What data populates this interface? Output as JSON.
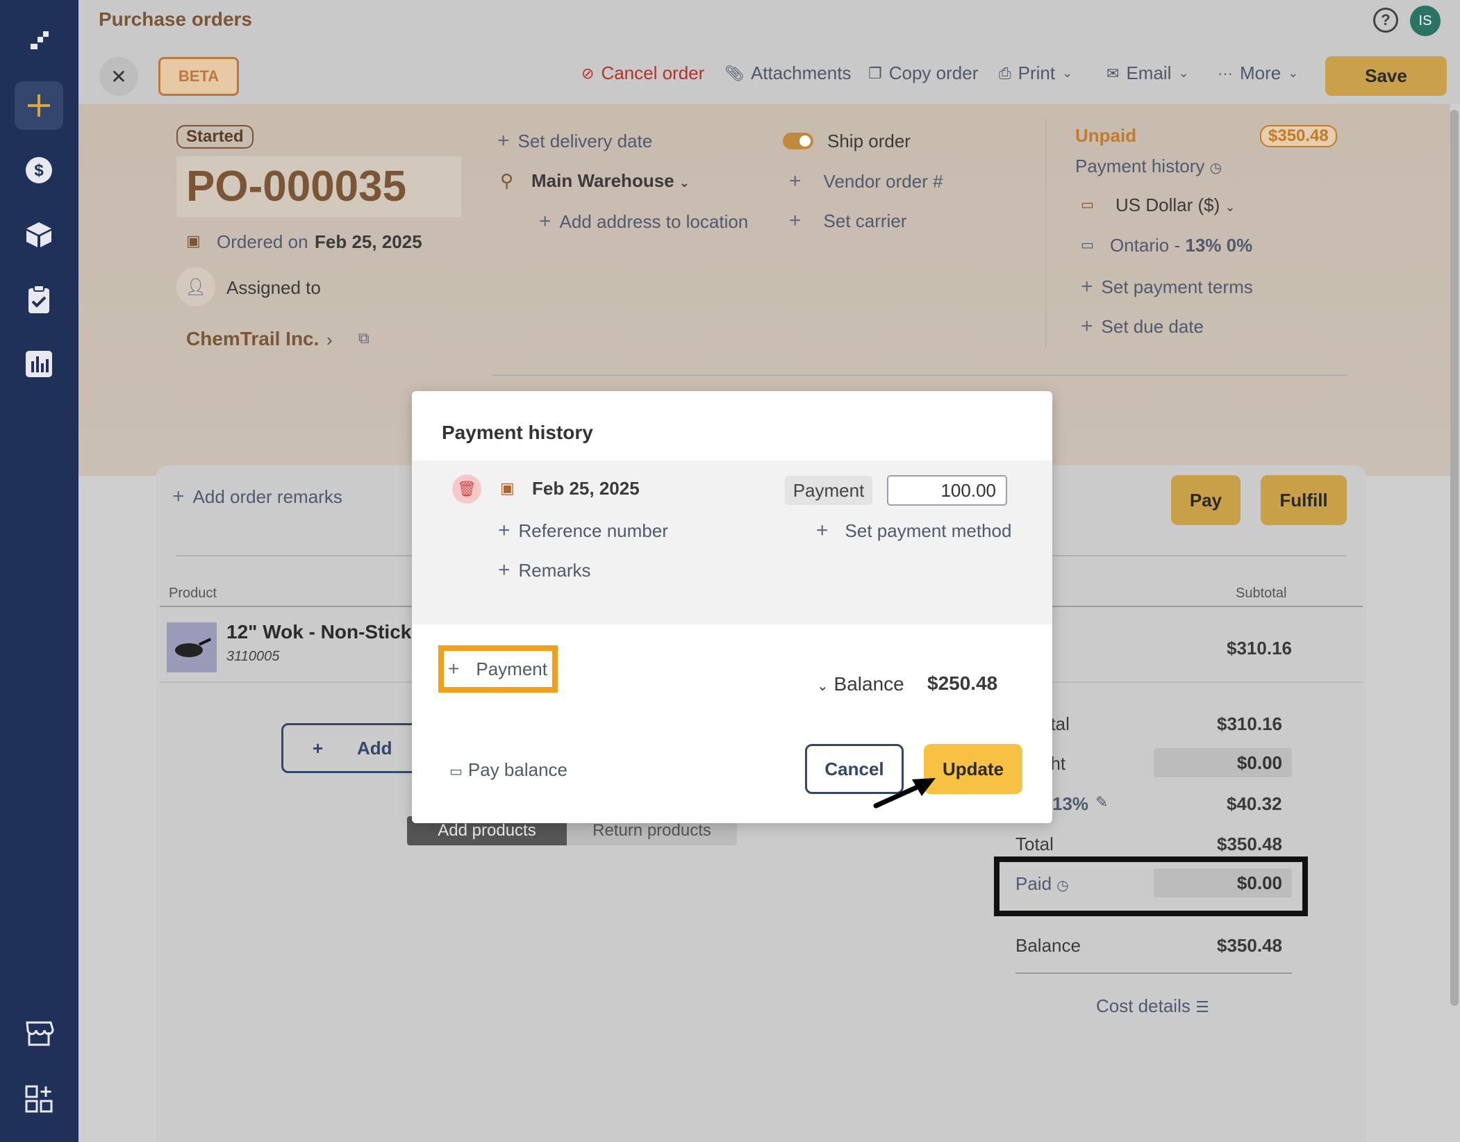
{
  "header": {
    "title": "Purchase orders",
    "beta": "BETA",
    "avatar": "IS",
    "help": "?",
    "toolbar": {
      "cancel_order": "Cancel order",
      "attachments": "Attachments",
      "copy_order": "Copy order",
      "print": "Print",
      "email": "Email",
      "more": "More",
      "save": "Save"
    }
  },
  "order": {
    "status": "Started",
    "number": "PO-000035",
    "ordered_on_label": "Ordered on",
    "ordered_on": "Feb 25, 2025",
    "assigned_to": "Assigned to",
    "vendor": "ChemTrail Inc.",
    "set_delivery_date": "Set delivery date",
    "location": "Main Warehouse",
    "add_address": "Add address to location",
    "ship_order": "Ship order",
    "vendor_order": "Vendor order #",
    "set_carrier": "Set carrier",
    "payment_status": "Unpaid",
    "payment_amount": "$350.48",
    "payment_history": "Payment history",
    "currency": "US Dollar ($)",
    "tax_region": "Ontario -",
    "tax_rates": "13% 0%",
    "set_payment_terms": "Set payment terms",
    "set_due_date": "Set due date",
    "add_remarks": "Add order remarks",
    "pay_btn": "Pay",
    "fulfill_btn": "Fulfill"
  },
  "products": {
    "col_product": "Product",
    "col_subtotal": "Subtotal",
    "rows": [
      {
        "name": "12\" Wok - Non-Stick",
        "sku": "3110005",
        "subtotal": "$310.16"
      }
    ],
    "add_btn": "Add",
    "tab_add": "Add products",
    "tab_return": "Return products"
  },
  "totals": {
    "subtotal_label": "otal",
    "subtotal": "$310.16",
    "freight_label": "ght",
    "freight": "$0.00",
    "tax_label": "13%",
    "tax": "$40.32",
    "total_label": "Total",
    "total": "$350.48",
    "paid_label": "Paid",
    "paid": "$0.00",
    "balance_label": "Balance",
    "balance": "$350.48",
    "cost_details": "Cost details"
  },
  "modal": {
    "title": "Payment history",
    "date": "Feb 25, 2025",
    "type": "Payment",
    "amount": "100.00",
    "reference": "Reference number",
    "set_method": "Set payment method",
    "remarks": "Remarks",
    "add_payment": "Payment",
    "balance_label": "Balance",
    "balance": "$250.48",
    "pay_balance": "Pay balance",
    "cancel": "Cancel",
    "update": "Update"
  }
}
